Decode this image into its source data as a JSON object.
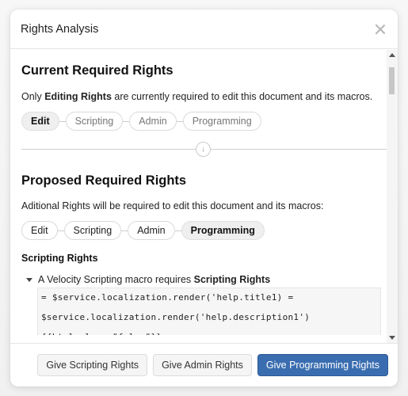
{
  "modal": {
    "title": "Rights Analysis",
    "close_icon": "close-icon"
  },
  "current": {
    "title": "Current Required Rights",
    "desc_prefix": "Only ",
    "desc_bold": "Editing Rights",
    "desc_suffix": " are currently required to edit this document and its macros.",
    "pills": [
      {
        "label": "Edit",
        "active": true
      },
      {
        "label": "Scripting",
        "active": false
      },
      {
        "label": "Admin",
        "active": false
      },
      {
        "label": "Programming",
        "active": false
      }
    ]
  },
  "divider_icon": "arrow-down-icon",
  "proposed": {
    "title": "Proposed Required Rights",
    "desc": "Aditional Rights will be required to edit this document and its macros:",
    "pills": [
      {
        "label": "Edit",
        "active": false
      },
      {
        "label": "Scripting",
        "active": false
      },
      {
        "label": "Admin",
        "active": false
      },
      {
        "label": "Programming",
        "active": true
      }
    ],
    "section_title": "Scripting Rights",
    "item": {
      "prefix": "A Velocity Scripting macro requires ",
      "bold": "Scripting Rights",
      "expanded": true,
      "code_lines": [
        "= $service.localization.render('help.title1) =",
        "$service.localization.render('help.description1')",
        "{{html clean=\"false\"}}"
      ]
    }
  },
  "footer": {
    "buttons": [
      {
        "label": "Give Scripting Rights",
        "primary": false
      },
      {
        "label": "Give Admin Rights",
        "primary": false
      },
      {
        "label": "Give Programming Rights",
        "primary": true
      }
    ]
  },
  "colors": {
    "primary": "#3a6db0",
    "active_pill": "#efefef"
  }
}
